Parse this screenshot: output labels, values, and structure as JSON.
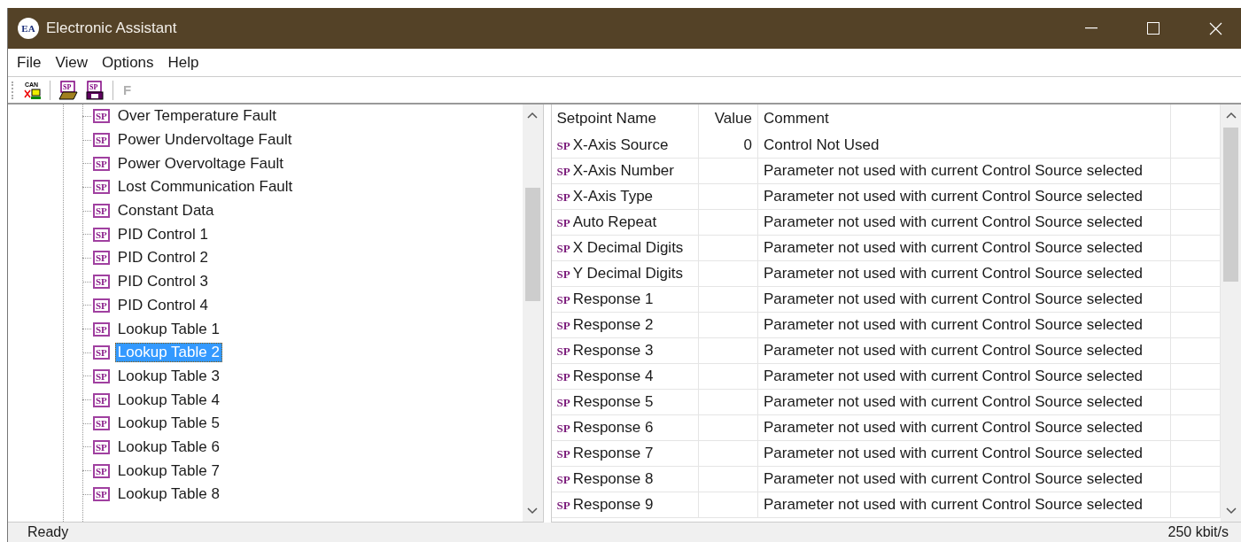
{
  "window": {
    "title": "Electronic Assistant",
    "app_badge": "EA"
  },
  "menu": [
    "File",
    "View",
    "Options",
    "Help"
  ],
  "toolbar": [
    {
      "kind": "can",
      "label": "CAN",
      "disabled": false
    },
    {
      "kind": "open",
      "label": "SP",
      "disabled": false
    },
    {
      "kind": "save",
      "label": "SP",
      "disabled": false
    },
    {
      "kind": "letter",
      "label": "F",
      "disabled": true
    }
  ],
  "tree": {
    "items": [
      {
        "badge": "SP",
        "label": "Over Temperature Fault",
        "selected": false
      },
      {
        "badge": "SP",
        "label": "Power Undervoltage Fault",
        "selected": false
      },
      {
        "badge": "SP",
        "label": "Power Overvoltage Fault",
        "selected": false
      },
      {
        "badge": "SP",
        "label": "Lost Communication Fault",
        "selected": false
      },
      {
        "badge": "SP",
        "label": "Constant Data",
        "selected": false
      },
      {
        "badge": "SP",
        "label": "PID Control 1",
        "selected": false
      },
      {
        "badge": "SP",
        "label": "PID Control 2",
        "selected": false
      },
      {
        "badge": "SP",
        "label": "PID Control 3",
        "selected": false
      },
      {
        "badge": "SP",
        "label": "PID Control 4",
        "selected": false
      },
      {
        "badge": "SP",
        "label": "Lookup Table 1",
        "selected": false
      },
      {
        "badge": "SP",
        "label": "Lookup Table 2",
        "selected": true
      },
      {
        "badge": "SP",
        "label": "Lookup Table 3",
        "selected": false
      },
      {
        "badge": "SP",
        "label": "Lookup Table 4",
        "selected": false
      },
      {
        "badge": "SP",
        "label": "Lookup Table 5",
        "selected": false
      },
      {
        "badge": "SP",
        "label": "Lookup Table 6",
        "selected": false
      },
      {
        "badge": "SP",
        "label": "Lookup Table 7",
        "selected": false
      },
      {
        "badge": "SP",
        "label": "Lookup Table 8",
        "selected": false
      }
    ]
  },
  "table": {
    "columns": [
      "Setpoint Name",
      "Value",
      "Comment"
    ],
    "rows": [
      {
        "badge": "SP",
        "name": "X-Axis Source",
        "value": "0",
        "comment": "Control Not Used"
      },
      {
        "badge": "SP",
        "name": "X-Axis Number",
        "value": "",
        "comment": "Parameter not used with current Control Source selected"
      },
      {
        "badge": "SP",
        "name": "X-Axis Type",
        "value": "",
        "comment": "Parameter not used with current Control Source selected"
      },
      {
        "badge": "SP",
        "name": "Auto Repeat",
        "value": "",
        "comment": "Parameter not used with current Control Source selected"
      },
      {
        "badge": "SP",
        "name": "X Decimal Digits",
        "value": "",
        "comment": "Parameter not used with current Control Source selected"
      },
      {
        "badge": "SP",
        "name": "Y Decimal Digits",
        "value": "",
        "comment": "Parameter not used with current Control Source selected"
      },
      {
        "badge": "SP",
        "name": "Response 1",
        "value": "",
        "comment": "Parameter not used with current Control Source selected"
      },
      {
        "badge": "SP",
        "name": "Response 2",
        "value": "",
        "comment": "Parameter not used with current Control Source selected"
      },
      {
        "badge": "SP",
        "name": "Response 3",
        "value": "",
        "comment": "Parameter not used with current Control Source selected"
      },
      {
        "badge": "SP",
        "name": "Response 4",
        "value": "",
        "comment": "Parameter not used with current Control Source selected"
      },
      {
        "badge": "SP",
        "name": "Response 5",
        "value": "",
        "comment": "Parameter not used with current Control Source selected"
      },
      {
        "badge": "SP",
        "name": "Response 6",
        "value": "",
        "comment": "Parameter not used with current Control Source selected"
      },
      {
        "badge": "SP",
        "name": "Response 7",
        "value": "",
        "comment": "Parameter not used with current Control Source selected"
      },
      {
        "badge": "SP",
        "name": "Response 8",
        "value": "",
        "comment": "Parameter not used with current Control Source selected"
      },
      {
        "badge": "SP",
        "name": "Response 9",
        "value": "",
        "comment": "Parameter not used with current Control Source selected"
      }
    ]
  },
  "status_bar": {
    "left": "Ready",
    "right": "250 kbit/s"
  }
}
